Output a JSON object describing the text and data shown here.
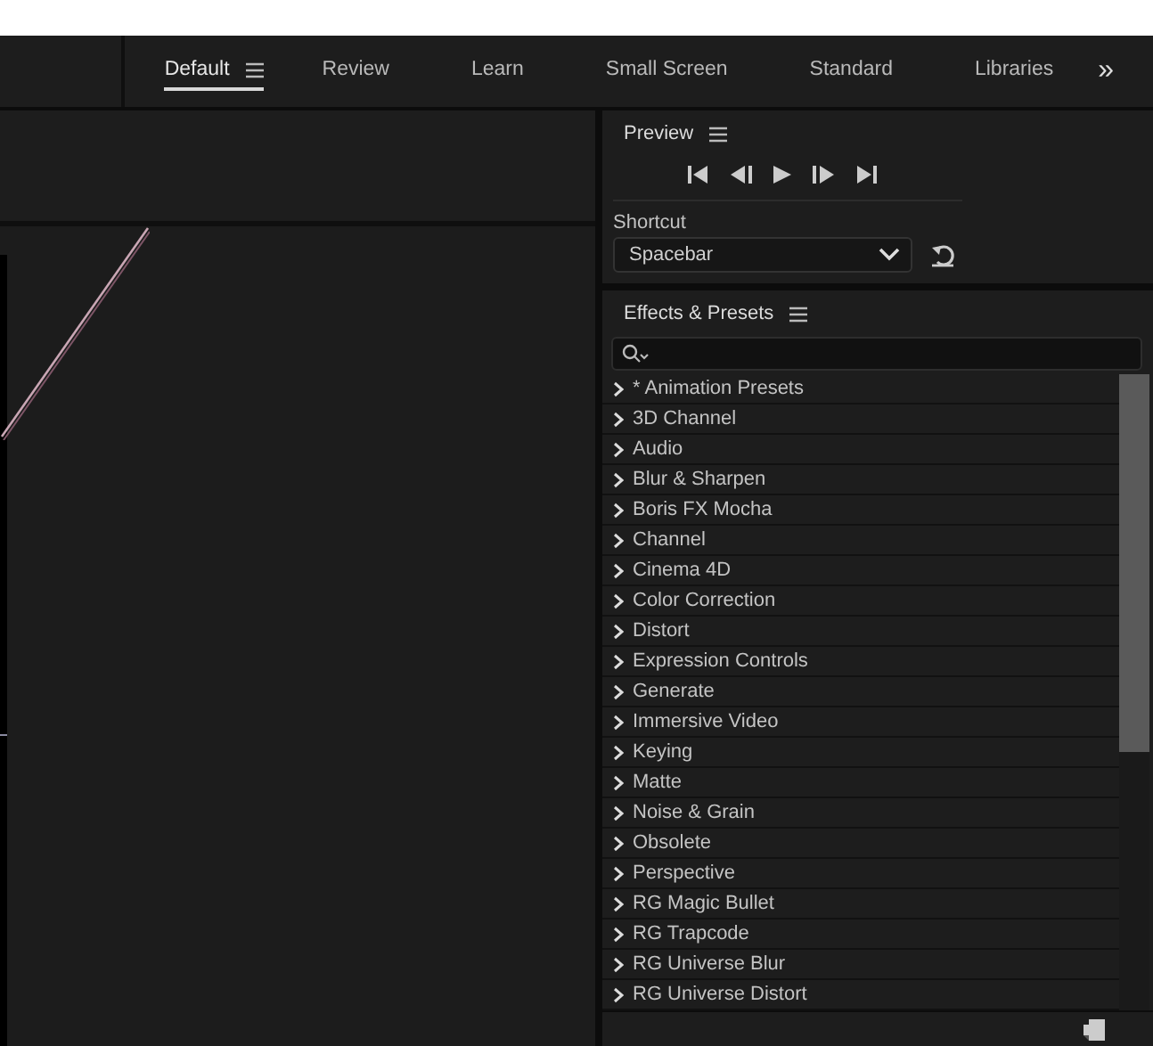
{
  "workspaces": {
    "tabs": [
      {
        "label": "Default",
        "selected": true,
        "menu": true
      },
      {
        "label": "Review",
        "selected": false
      },
      {
        "label": "Learn",
        "selected": false
      },
      {
        "label": "Small Screen",
        "selected": false
      },
      {
        "label": "Standard",
        "selected": false
      },
      {
        "label": "Libraries",
        "selected": false
      }
    ],
    "overflow": "»"
  },
  "preview": {
    "title": "Preview",
    "shortcut_label": "Shortcut",
    "shortcut_value": "Spacebar"
  },
  "effects": {
    "title": "Effects & Presets",
    "items": [
      {
        "label": "* Animation Presets"
      },
      {
        "label": "3D Channel"
      },
      {
        "label": "Audio"
      },
      {
        "label": "Blur & Sharpen"
      },
      {
        "label": "Boris FX Mocha"
      },
      {
        "label": "Channel"
      },
      {
        "label": "Cinema 4D"
      },
      {
        "label": "Color Correction"
      },
      {
        "label": "Distort"
      },
      {
        "label": "Expression Controls"
      },
      {
        "label": "Generate"
      },
      {
        "label": "Immersive Video"
      },
      {
        "label": "Keying"
      },
      {
        "label": "Matte"
      },
      {
        "label": "Noise & Grain"
      },
      {
        "label": "Obsolete"
      },
      {
        "label": "Perspective"
      },
      {
        "label": "RG Magic Bullet"
      },
      {
        "label": "RG Trapcode"
      },
      {
        "label": "RG Universe Blur"
      },
      {
        "label": "RG Universe Distort"
      }
    ]
  }
}
